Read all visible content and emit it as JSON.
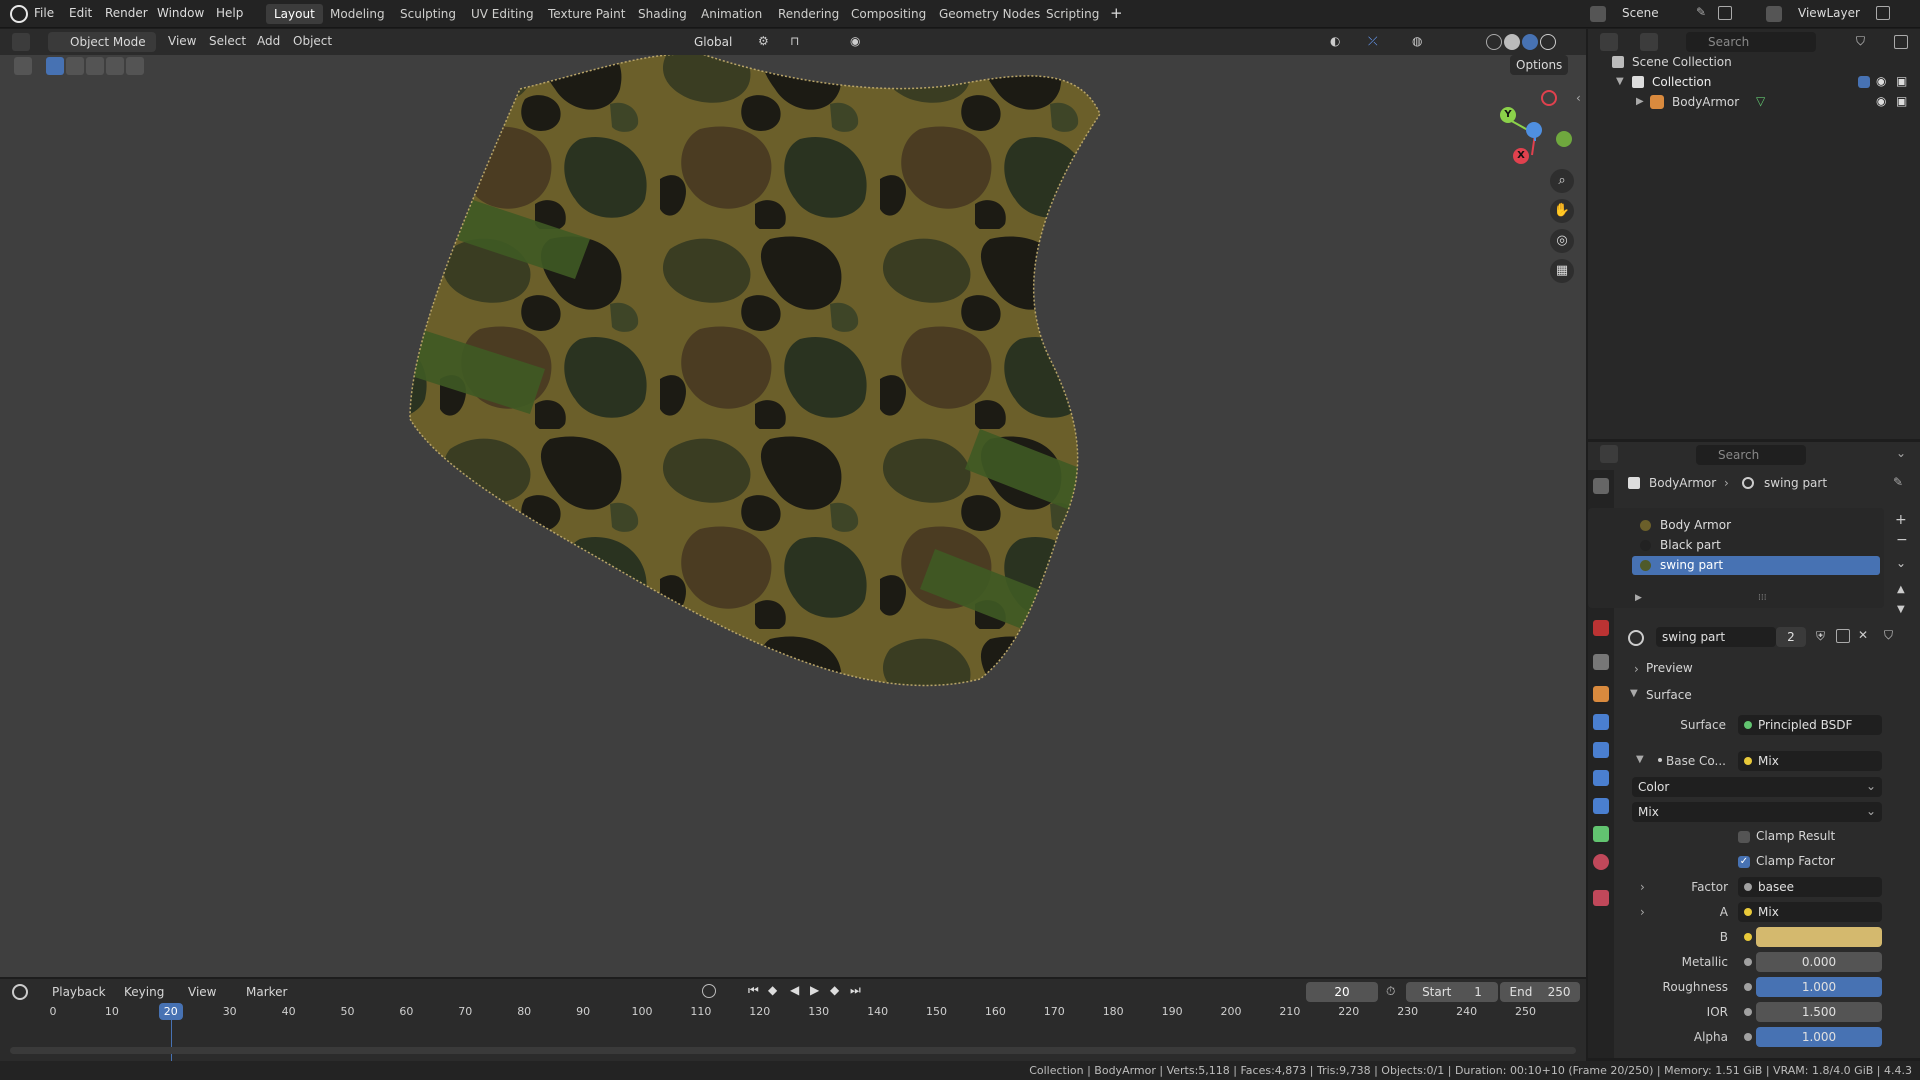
{
  "topbar": {
    "menus": [
      "File",
      "Edit",
      "Render",
      "Window",
      "Help"
    ],
    "workspaces": [
      "Layout",
      "Modeling",
      "Sculpting",
      "UV Editing",
      "Texture Paint",
      "Shading",
      "Animation",
      "Rendering",
      "Compositing",
      "Geometry Nodes",
      "Scripting"
    ],
    "active_workspace": "Layout",
    "add_tab": "+",
    "scene": "Scene",
    "view_layer": "ViewLayer"
  },
  "viewport": {
    "mode": "Object Mode",
    "menus": [
      "View",
      "Select",
      "Add",
      "Object"
    ],
    "transform_orientation": "Global",
    "options": "Options",
    "gizmo_axes": {
      "y": "Y",
      "x": "X"
    }
  },
  "outliner": {
    "search_placeholder": "Search",
    "root": "Scene Collection",
    "collection": "Collection",
    "object": "BodyArmor"
  },
  "properties": {
    "search_placeholder": "Search",
    "breadcrumb_object": "BodyArmor",
    "breadcrumb_material": "swing part",
    "materials": [
      "Body Armor",
      "Black part",
      "swing part"
    ],
    "selected_material": "swing part",
    "material_name": "swing part",
    "user_count": "2",
    "preview": "Preview",
    "surface_panel": "Surface",
    "surface_label": "Surface",
    "surface_value": "Principled BSDF",
    "base_color_label": "Base Co...",
    "base_color_value": "Mix",
    "data_type": "Color",
    "blend_type": "Mix",
    "clamp_result": "Clamp Result",
    "clamp_factor": "Clamp Factor",
    "clamp_result_checked": false,
    "clamp_factor_checked": true,
    "factor_label": "Factor",
    "factor_value": "basee",
    "a_label": "A",
    "a_value": "Mix",
    "b_label": "B",
    "b_color": "#d4b96e",
    "metallic_label": "Metallic",
    "metallic_value": "0.000",
    "roughness_label": "Roughness",
    "roughness_value": "1.000",
    "ior_label": "IOR",
    "ior_value": "1.500",
    "alpha_label": "Alpha",
    "alpha_value": "1.000"
  },
  "timeline": {
    "menus": [
      "Playback",
      "Keying",
      "View",
      "Marker"
    ],
    "current_frame": "20",
    "start_label": "Start",
    "start_value": "1",
    "end_label": "End",
    "end_value": "250",
    "ticks": [
      "0",
      "10",
      "20",
      "30",
      "40",
      "50",
      "60",
      "70",
      "80",
      "90",
      "100",
      "110",
      "120",
      "130",
      "140",
      "150",
      "160",
      "170",
      "180",
      "190",
      "200",
      "210",
      "220",
      "230",
      "240",
      "250"
    ]
  },
  "statusbar": {
    "text": "Collection | BodyArmor | Verts:5,118 | Faces:4,873 | Tris:9,738 | Objects:0/1 | Duration: 00:10+10 (Frame 20/250) | Memory: 1.51 GiB | VRAM: 1.8/4.0 GiB | 4.4.3"
  },
  "colors": {
    "accent": "#4772b3",
    "x_axis": "#e0414e",
    "y_axis": "#8bd14a",
    "z_axis": "#4f8fe0"
  }
}
